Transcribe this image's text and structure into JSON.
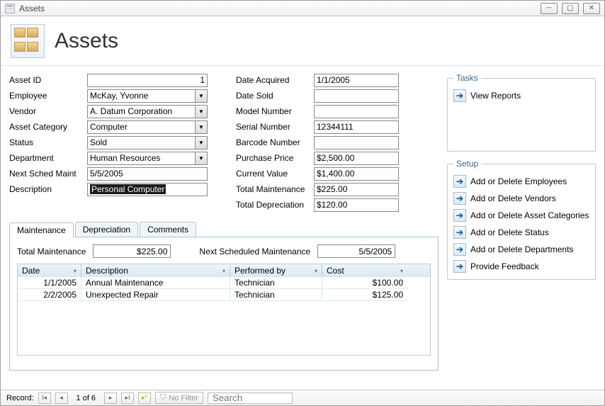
{
  "window": {
    "title": "Assets"
  },
  "header": {
    "title": "Assets"
  },
  "left_fields": {
    "asset_id_label": "Asset ID",
    "asset_id": "1",
    "employee_label": "Employee",
    "employee": "McKay, Yvonne",
    "vendor_label": "Vendor",
    "vendor": "A. Datum Corporation",
    "category_label": "Asset Category",
    "category": "Computer",
    "status_label": "Status",
    "status": "Sold",
    "department_label": "Department",
    "department": "Human Resources",
    "next_maint_label": "Next Sched Maint",
    "next_maint": "5/5/2005",
    "description_label": "Description",
    "description": "Personal Computer"
  },
  "right_fields": {
    "date_acquired_label": "Date Acquired",
    "date_acquired": "1/1/2005",
    "date_sold_label": "Date Sold",
    "date_sold": "",
    "model_label": "Model Number",
    "model": "",
    "serial_label": "Serial Number",
    "serial": "12344111",
    "barcode_label": "Barcode Number",
    "barcode": "",
    "purchase_label": "Purchase Price",
    "purchase": "$2,500.00",
    "current_label": "Current Value",
    "current": "$1,400.00",
    "total_maint_label": "Total Maintenance",
    "total_maint": "$225.00",
    "total_depr_label": "Total Depreciation",
    "total_depr": "$120.00"
  },
  "tabs": {
    "maintenance": "Maintenance",
    "depreciation": "Depreciation",
    "comments": "Comments"
  },
  "maint_panel": {
    "total_label": "Total Maintenance",
    "total": "$225.00",
    "next_label": "Next Scheduled Maintenance",
    "next": "5/5/2005",
    "headers": {
      "date": "Date",
      "desc": "Description",
      "perf": "Performed by",
      "cost": "Cost"
    },
    "rows": [
      {
        "date": "1/1/2005",
        "desc": "Annual Maintenance",
        "perf": "Technician",
        "cost": "$100.00"
      },
      {
        "date": "2/2/2005",
        "desc": "Unexpected Repair",
        "perf": "Technician",
        "cost": "$125.00"
      }
    ]
  },
  "side": {
    "tasks_title": "Tasks",
    "view_reports": "View Reports",
    "setup_title": "Setup",
    "add_emp": "Add or Delete Employees",
    "add_ven": "Add or Delete Vendors",
    "add_cat": "Add or Delete Asset Categories",
    "add_stat": "Add or Delete Status",
    "add_dept": "Add or Delete Departments",
    "feedback": "Provide Feedback"
  },
  "statusbar": {
    "record_label": "Record:",
    "position": "1 of 6",
    "no_filter": "No Filter",
    "search_placeholder": "Search"
  }
}
